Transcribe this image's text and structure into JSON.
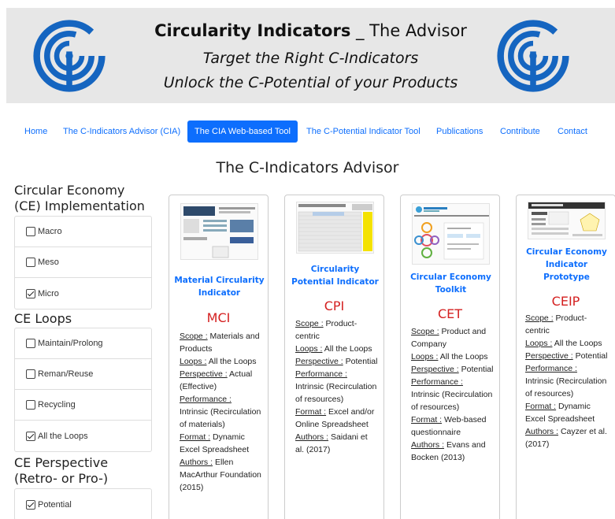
{
  "banner": {
    "title_bold": "Circularity Indicators",
    "title_rest": " _ The Advisor",
    "line2": "Target the Right C-Indicators",
    "line3": "Unlock the C-Potential of your Products",
    "color_primary": "#1565c0"
  },
  "nav": {
    "items": [
      {
        "label": "Home"
      },
      {
        "label": "The C-Indicators Advisor (CIA)"
      },
      {
        "label": "The CIA Web-based Tool",
        "active": true
      },
      {
        "label": "The C-Potential Indicator Tool"
      },
      {
        "label": "Publications"
      },
      {
        "label": "Contribute"
      },
      {
        "label": "Contact"
      }
    ],
    "active_color": "#0d6efd"
  },
  "main": {
    "title": "The C-Indicators Advisor"
  },
  "filters": {
    "implementation": {
      "title": "Circular Economy (CE) Implementation Level",
      "options": [
        {
          "label": "Macro",
          "checked": false
        },
        {
          "label": "Meso",
          "checked": false
        },
        {
          "label": "Micro",
          "checked": true
        }
      ]
    },
    "loops": {
      "title": "CE Loops",
      "options": [
        {
          "label": "Maintain/Prolong",
          "checked": false
        },
        {
          "label": "Reman/Reuse",
          "checked": false
        },
        {
          "label": "Recycling",
          "checked": false
        },
        {
          "label": "All the Loops",
          "checked": true
        }
      ]
    },
    "perspective": {
      "title": "CE Perspective (Retro- or Pro-)",
      "options": [
        {
          "label": "Potential",
          "checked": true
        }
      ]
    }
  },
  "cards": [
    {
      "title": "Material Circularity Indicator",
      "abbr": "MCI",
      "fields": [
        {
          "label": "Scope :",
          "value": " Materials and Products"
        },
        {
          "label": "Loops :",
          "value": " All the Loops"
        },
        {
          "label": "Perspective :",
          "value": " Actual (Effective)"
        },
        {
          "label": "Performance :",
          "value": " Intrinsic (Recirculation of materials)"
        },
        {
          "label": "Format :",
          "value": " Dynamic Excel Spreadsheet"
        },
        {
          "label": "Authors :",
          "value": " Ellen MacArthur Foundation (2015)"
        }
      ]
    },
    {
      "title": "Circularity Potential Indicator",
      "abbr": "CPI",
      "fields": [
        {
          "label": "Scope :",
          "value": " Product-centric"
        },
        {
          "label": "Loops :",
          "value": " All the Loops"
        },
        {
          "label": "Perspective :",
          "value": " Potential"
        },
        {
          "label": "Performance :",
          "value": " Intrinsic (Recirculation of resources)"
        },
        {
          "label": "Format :",
          "value": " Excel and/or Online Spreadsheet"
        },
        {
          "label": "Authors :",
          "value": " Saidani et al. (2017)"
        }
      ]
    },
    {
      "title": "Circular Economy Toolkit",
      "abbr": "CET",
      "fields": [
        {
          "label": "Scope :",
          "value": " Product and Company"
        },
        {
          "label": "Loops :",
          "value": " All the Loops"
        },
        {
          "label": "Perspective :",
          "value": " Potential"
        },
        {
          "label": "Performance :",
          "value": " Intrinsic (Recirculation of resources)"
        },
        {
          "label": "Format :",
          "value": " Web-based questionnaire"
        },
        {
          "label": "Authors :",
          "value": " Evans and Bocken (2013)"
        }
      ]
    },
    {
      "title": "Circular Economy Indicator Prototype",
      "abbr": "CEIP",
      "fields": [
        {
          "label": "Scope :",
          "value": " Product-centric"
        },
        {
          "label": "Loops :",
          "value": " All the Loops"
        },
        {
          "label": "Perspective :",
          "value": " Potential"
        },
        {
          "label": "Performance :",
          "value": " Intrinsic (Recirculation of resources)"
        },
        {
          "label": "Format :",
          "value": " Dynamic Excel Spreadsheet"
        },
        {
          "label": "Authors :",
          "value": " Cayzer et al. (2017)"
        }
      ]
    }
  ]
}
